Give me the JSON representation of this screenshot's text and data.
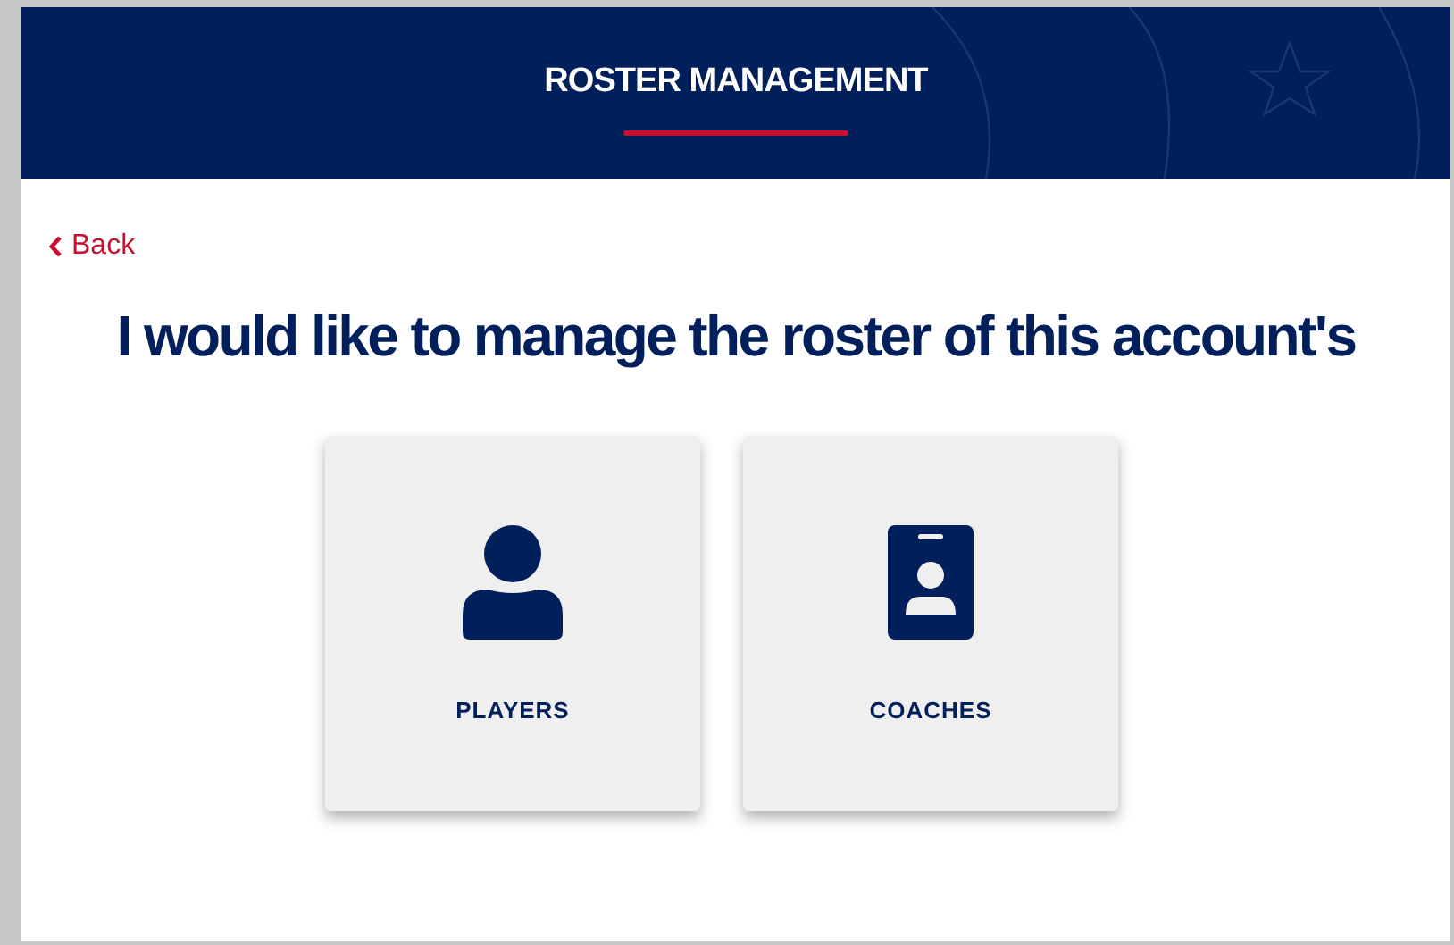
{
  "header": {
    "title": "ROSTER MANAGEMENT"
  },
  "back_link": {
    "label": "Back"
  },
  "heading": "I would like to manage the roster of this account's",
  "options": [
    {
      "kind": "person",
      "label": "PLAYERS"
    },
    {
      "kind": "badge",
      "label": "COACHES"
    }
  ]
}
